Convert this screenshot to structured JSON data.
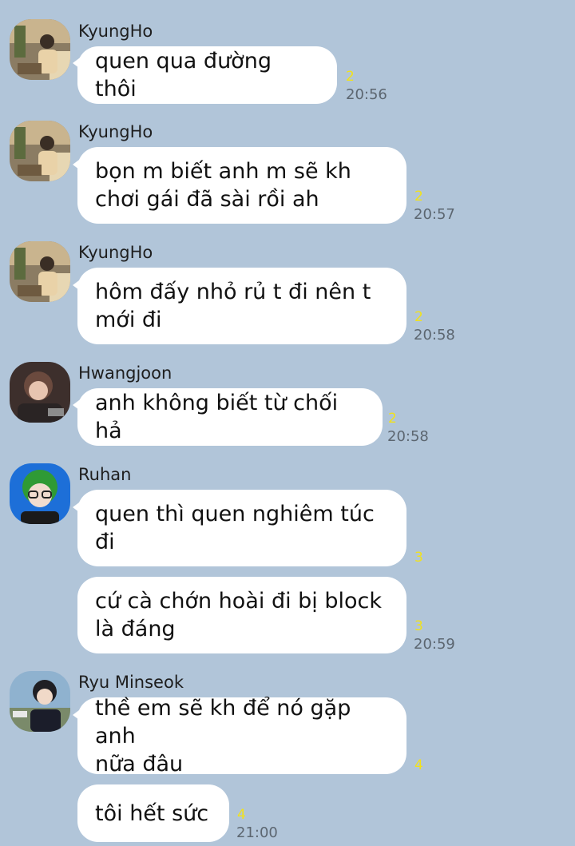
{
  "colors": {
    "background": "#b1c5d9",
    "bubble": "#ffffff",
    "unread": "#f2e21a",
    "time": "#5c6670"
  },
  "messages": [
    {
      "sender": "KyungHo",
      "avatar": "kyungho-avatar-icon",
      "text": "quen qua đường thôi",
      "unread": "2",
      "time": "20:56"
    },
    {
      "sender": "KyungHo",
      "avatar": "kyungho-avatar-icon",
      "text": "bọn m biết anh m sẽ kh\nchơi gái đã sài rồi ah",
      "unread": "2",
      "time": "20:57"
    },
    {
      "sender": "KyungHo",
      "avatar": "kyungho-avatar-icon",
      "text": "hôm đấy nhỏ rủ t đi nên t\nmới đi",
      "unread": "2",
      "time": "20:58"
    },
    {
      "sender": "Hwangjoon",
      "avatar": "hwangjoon-avatar-icon",
      "text": "anh không biết từ chối hả",
      "unread": "2",
      "time": "20:58"
    },
    {
      "sender": "Ruhan",
      "avatar": "ruhan-avatar-icon",
      "text": "quen thì quen nghiêm túc\nđi",
      "unread": "3",
      "time": ""
    },
    {
      "sender": "",
      "avatar": "",
      "text": "cứ cà chớn hoài đi bị block\nlà đáng",
      "unread": "3",
      "time": "20:59"
    },
    {
      "sender": "Ryu Minseok",
      "avatar": "minseok-avatar-icon",
      "text": "thề em sẽ kh để nó gặp anh\nnữa đâu",
      "unread": "4",
      "time": ""
    },
    {
      "sender": "",
      "avatar": "",
      "text": "tôi hết sức",
      "unread": "4",
      "time": "21:00"
    }
  ]
}
